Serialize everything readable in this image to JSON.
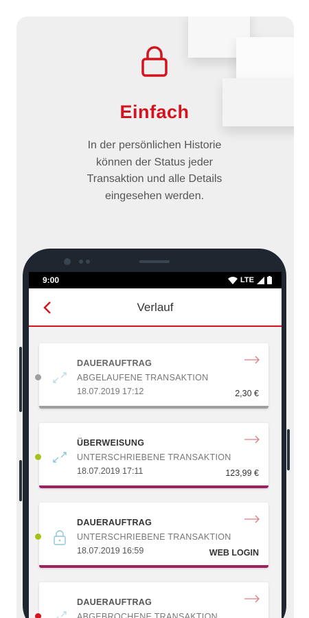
{
  "hero": {
    "title": "Einfach",
    "text_lines": [
      "In der persönlichen Historie",
      "können der Status jeder",
      "Transaktion und alle Details",
      "eingesehen werden."
    ]
  },
  "statusbar": {
    "time": "9:00",
    "network": "LTE"
  },
  "appbar": {
    "title": "Verlauf"
  },
  "transactions": [
    {
      "type": "DAUERAUFTRAG",
      "status": "ABGELAUFENE TRANSAKTION",
      "date": "18.07.2019 17:12",
      "amount": "2,30 €",
      "icon": "transfer-icon",
      "color": "#9e9e9e"
    },
    {
      "type": "ÜBERWEISUNG",
      "status": "UNTERSCHRIEBENE TRANSAKTION",
      "date": "18.07.2019 17:11",
      "amount": "123,99 €",
      "icon": "transfer-icon",
      "color": "#a0215f",
      "dot": "#a6c11a"
    },
    {
      "type": "DAUERAUFTRAG",
      "status": "UNTERSCHRIEBENE TRANSAKTION",
      "date": "18.07.2019 16:59",
      "amount": "WEB LOGIN",
      "icon": "lock-icon",
      "color": "#a0215f",
      "dot": "#a6c11a"
    },
    {
      "type": "DAUERAUFTRAG",
      "status": "ABGEBROCHENE TRANSAKTION",
      "icon": "transfer-icon",
      "dot": "#d3141f"
    }
  ],
  "colors": {
    "accent": "#d3141f",
    "signed_bar": "#a0215f",
    "expired_bar": "#9e9e9e",
    "signed_dot": "#a6c11a",
    "expired_dot": "#9e9e9e"
  }
}
